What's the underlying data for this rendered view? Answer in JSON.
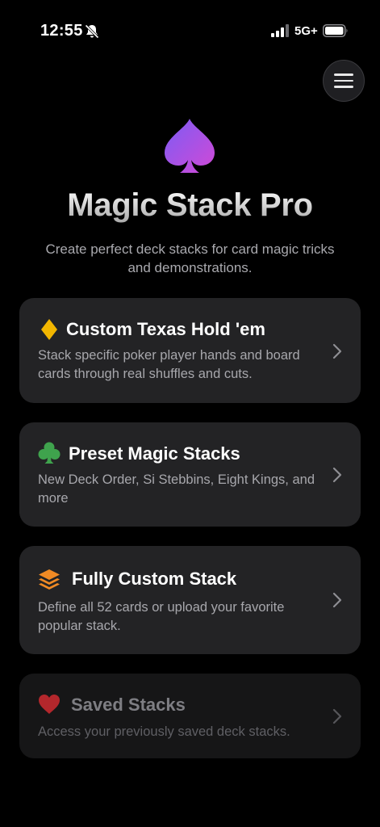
{
  "status_bar": {
    "time": "12:55",
    "network": "5G+",
    "icons": [
      "bell-slash-icon",
      "signal-icon",
      "battery-icon"
    ]
  },
  "menu": {
    "icon": "hamburger-icon"
  },
  "hero": {
    "icon": "spade-icon",
    "title": "Magic Stack Pro",
    "subtitle": "Create perfect deck stacks for card magic tricks and demonstrations.",
    "gradient_colors": [
      "#8b5cf6",
      "#c44ad8"
    ]
  },
  "cards": [
    {
      "icon": "diamond-icon",
      "icon_color": "#f2b600",
      "title": "Custom Texas Hold 'em",
      "description": "Stack specific poker player hands and board cards through real shuffles and cuts."
    },
    {
      "icon": "club-icon",
      "icon_color": "#3fa34d",
      "title": "Preset Magic Stacks",
      "description": "New Deck Order, Si Stebbins, Eight Kings, and more"
    },
    {
      "icon": "stack-layers-icon",
      "icon_color": "#f08a24",
      "title": "Fully Custom Stack",
      "description": "Define all 52 cards or upload your favorite popular stack."
    },
    {
      "icon": "heart-icon",
      "icon_color": "#c0282e",
      "title": "Saved Stacks",
      "description": "Access your previously saved deck stacks.",
      "disabled": true
    }
  ]
}
